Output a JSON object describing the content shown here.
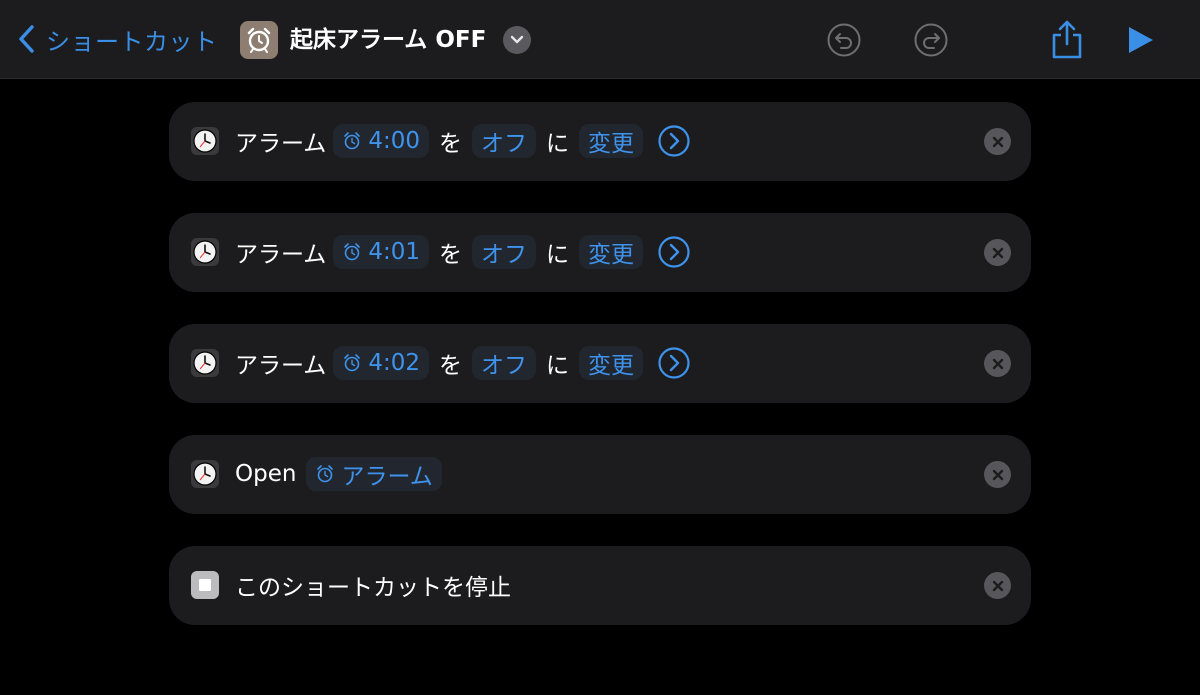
{
  "header": {
    "back_label": "ショートカット",
    "title": "起床アラーム OFF",
    "icons": [
      "chevron-left-icon",
      "alarm-clock-icon",
      "chevron-down-icon",
      "undo-icon",
      "redo-icon",
      "share-icon",
      "play-icon"
    ]
  },
  "actions": [
    {
      "verb": "アラーム",
      "time": "4:00",
      "particle1": "を",
      "state": "オフ",
      "particle2": "に",
      "op": "変更"
    },
    {
      "verb": "アラーム",
      "time": "4:01",
      "particle1": "を",
      "state": "オフ",
      "particle2": "に",
      "op": "変更"
    },
    {
      "verb": "アラーム",
      "time": "4:02",
      "particle1": "を",
      "state": "オフ",
      "particle2": "に",
      "op": "変更"
    }
  ],
  "open_action": {
    "verb": "Open",
    "target": "アラーム"
  },
  "stop_action": {
    "label": "このショートカットを停止"
  },
  "colors": {
    "accent": "#3a8ee6",
    "card": "#1c1c1e",
    "background": "#000000",
    "pill": "#22272f"
  }
}
